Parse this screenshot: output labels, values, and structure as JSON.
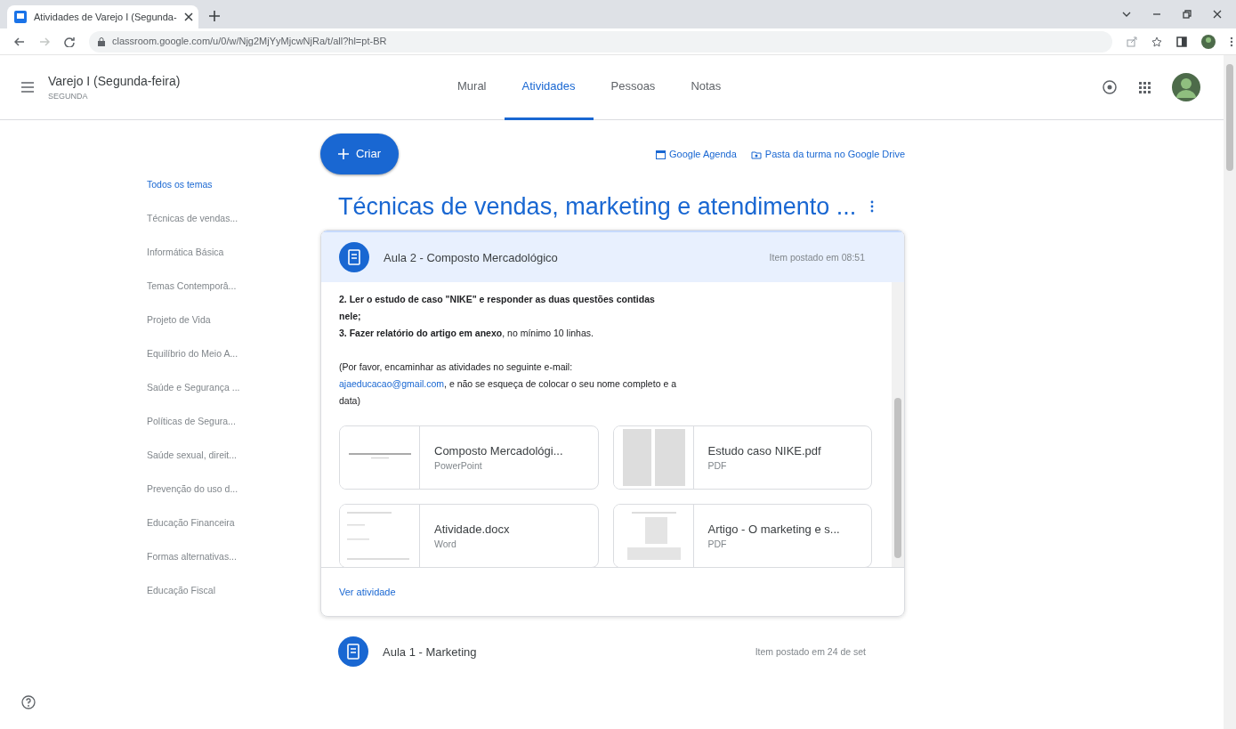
{
  "browser": {
    "tab_title": "Atividades de Varejo I (Segunda-",
    "url": "classroom.google.com/u/0/w/Njg2MjYyMjcwNjRa/t/all?hl=pt-BR"
  },
  "class": {
    "title": "Varejo I (Segunda-feira)",
    "subtitle": "SEGUNDA"
  },
  "nav_tabs": [
    {
      "label": "Mural",
      "selected": false
    },
    {
      "label": "Atividades",
      "selected": true
    },
    {
      "label": "Pessoas",
      "selected": false
    },
    {
      "label": "Notas",
      "selected": false
    }
  ],
  "create_button": "Criar",
  "links": [
    {
      "kind": "calendar",
      "label": "Google Agenda"
    },
    {
      "kind": "drive",
      "label": "Pasta da turma no Google Drive"
    }
  ],
  "topics": [
    {
      "label": "Todos os temas",
      "selected": true
    },
    {
      "label": "Técnicas de vendas...",
      "selected": false
    },
    {
      "label": "Informática Básica",
      "selected": false
    },
    {
      "label": "Temas Contemporâ...",
      "selected": false
    },
    {
      "label": "Projeto de Vida",
      "selected": false
    },
    {
      "label": "Equilíbrio do Meio A...",
      "selected": false
    },
    {
      "label": "Saúde e Segurança ...",
      "selected": false
    },
    {
      "label": "Políticas de Segura...",
      "selected": false
    },
    {
      "label": "Saúde sexual, direit...",
      "selected": false
    },
    {
      "label": "Prevenção do uso d...",
      "selected": false
    },
    {
      "label": "Educação Financeira",
      "selected": false
    },
    {
      "label": "Formas alternativas...",
      "selected": false
    },
    {
      "label": "Educação Fiscal",
      "selected": false
    }
  ],
  "section_title": "Técnicas de vendas, marketing e atendimento ...",
  "posts": [
    {
      "title": "Aula 2 - Composto Mercadológico",
      "time": "Item postado em 08:51",
      "expanded": true,
      "description": [
        "**2. Ler o estudo de caso \"NIKE\" e responder as duas questões contidas nele;**",
        "**3. Fazer relatório do artigo em anexo**, no mínimo 10 linhas."
      ],
      "note": {
        "before": "(Por favor, encaminhar as atividades no seguinte e-mail:",
        "email": "ajaeducacao@gmail.com",
        "after": ", e não se esqueça de colocar o seu nome completo e a data)"
      },
      "attachments": [
        {
          "kind": "slides",
          "name": "Composto Mercadológi...",
          "type": "PowerPoint"
        },
        {
          "kind": "pdf",
          "name": "Estudo caso NIKE.pdf",
          "type": "PDF"
        },
        {
          "kind": "doc",
          "name": "Atividade.docx",
          "type": "Word"
        },
        {
          "kind": "article",
          "name": "Artigo - O marketing e s...",
          "type": "PDF"
        }
      ],
      "action": "Ver atividade"
    },
    {
      "title": "Aula 1 - Marketing",
      "time": "Item postado em 24 de set",
      "expanded": false
    }
  ]
}
